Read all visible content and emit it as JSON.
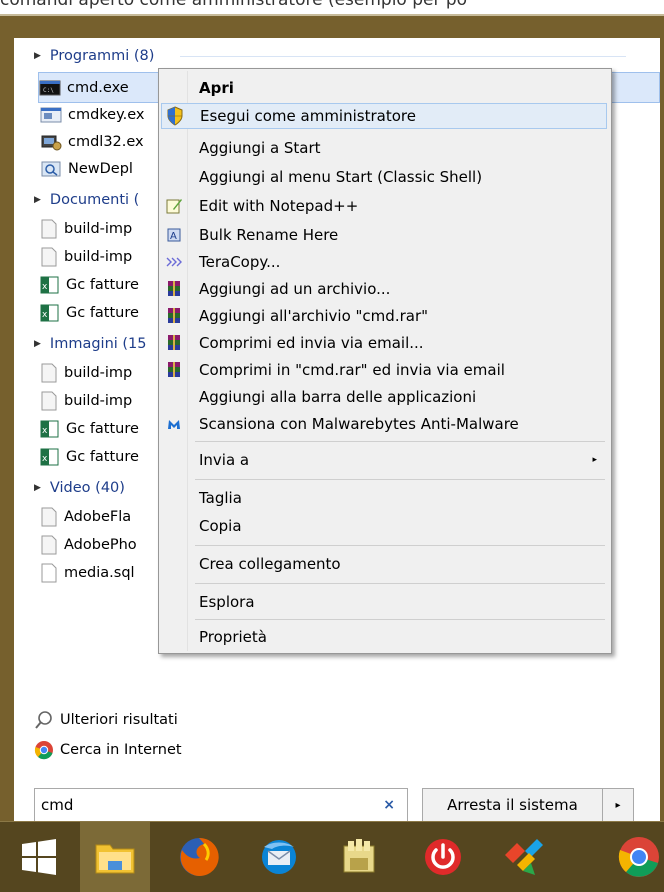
{
  "caption": "comandi aperto come amministratore (esempio per po",
  "groups": [
    {
      "label": "Programmi (8)"
    },
    {
      "label": "Documenti ("
    },
    {
      "label": "Immagini (15"
    },
    {
      "label": "Video (40)"
    }
  ],
  "programs": [
    "cmd.exe",
    "cmdkey.ex",
    "cmdl32.ex",
    "NewDepl"
  ],
  "documents": [
    "build-imp",
    "build-imp",
    "Gc fatture",
    "Gc fatture"
  ],
  "images": [
    "build-imp",
    "build-imp",
    "Gc fatture",
    "Gc fatture"
  ],
  "videos": [
    "AdobeFla",
    "AdobePho",
    "media.sql"
  ],
  "links": {
    "more_results": "Ulteriori risultati",
    "search_internet": "Cerca in Internet"
  },
  "search": {
    "value": "cmd",
    "clear": "×"
  },
  "shutdown": {
    "label": "Arresta il sistema",
    "arrow": "▸"
  },
  "menu": {
    "items": [
      {
        "label": "Apri",
        "icon": "none"
      },
      {
        "label": "Esegui come amministratore",
        "icon": "uac-shield-icon"
      },
      {
        "label": "Aggiungi a Start",
        "icon": "none"
      },
      {
        "label": "Aggiungi al menu Start (Classic Shell)",
        "icon": "none"
      },
      {
        "label": "Edit with Notepad++",
        "icon": "notepad-icon"
      },
      {
        "label": "Bulk Rename Here",
        "icon": "bulk-rename-icon"
      },
      {
        "label": "TeraCopy...",
        "icon": "teracopy-icon"
      },
      {
        "label": "Aggiungi ad un archivio...",
        "icon": "winrar-icon"
      },
      {
        "label": "Aggiungi all'archivio \"cmd.rar\"",
        "icon": "winrar-icon"
      },
      {
        "label": "Comprimi ed invia via email...",
        "icon": "winrar-icon"
      },
      {
        "label": "Comprimi in \"cmd.rar\" ed invia via email",
        "icon": "winrar-icon"
      },
      {
        "label": "Aggiungi alla barra delle applicazioni",
        "icon": "none"
      },
      {
        "label": "Scansiona con Malwarebytes Anti-Malware",
        "icon": "malwarebytes-icon"
      },
      {
        "label": "Invia a",
        "icon": "none"
      },
      {
        "label": "Taglia",
        "icon": "none"
      },
      {
        "label": "Copia",
        "icon": "none"
      },
      {
        "label": "Crea collegamento",
        "icon": "none"
      },
      {
        "label": "Esplora",
        "icon": "none"
      },
      {
        "label": "Proprietà",
        "icon": "none"
      }
    ],
    "submenu_arrow": "▸"
  },
  "taskbar": [
    "windows-start-icon",
    "file-explorer-icon",
    "firefox-icon",
    "thunderbird-icon",
    "library-icon",
    "shutdown-app-icon",
    "app-icon",
    "chrome-icon"
  ],
  "colors": {
    "frame": "#76602d",
    "taskbar": "#55461f",
    "group_text": "#1e3d8a",
    "highlight": "#e2ecf7"
  }
}
